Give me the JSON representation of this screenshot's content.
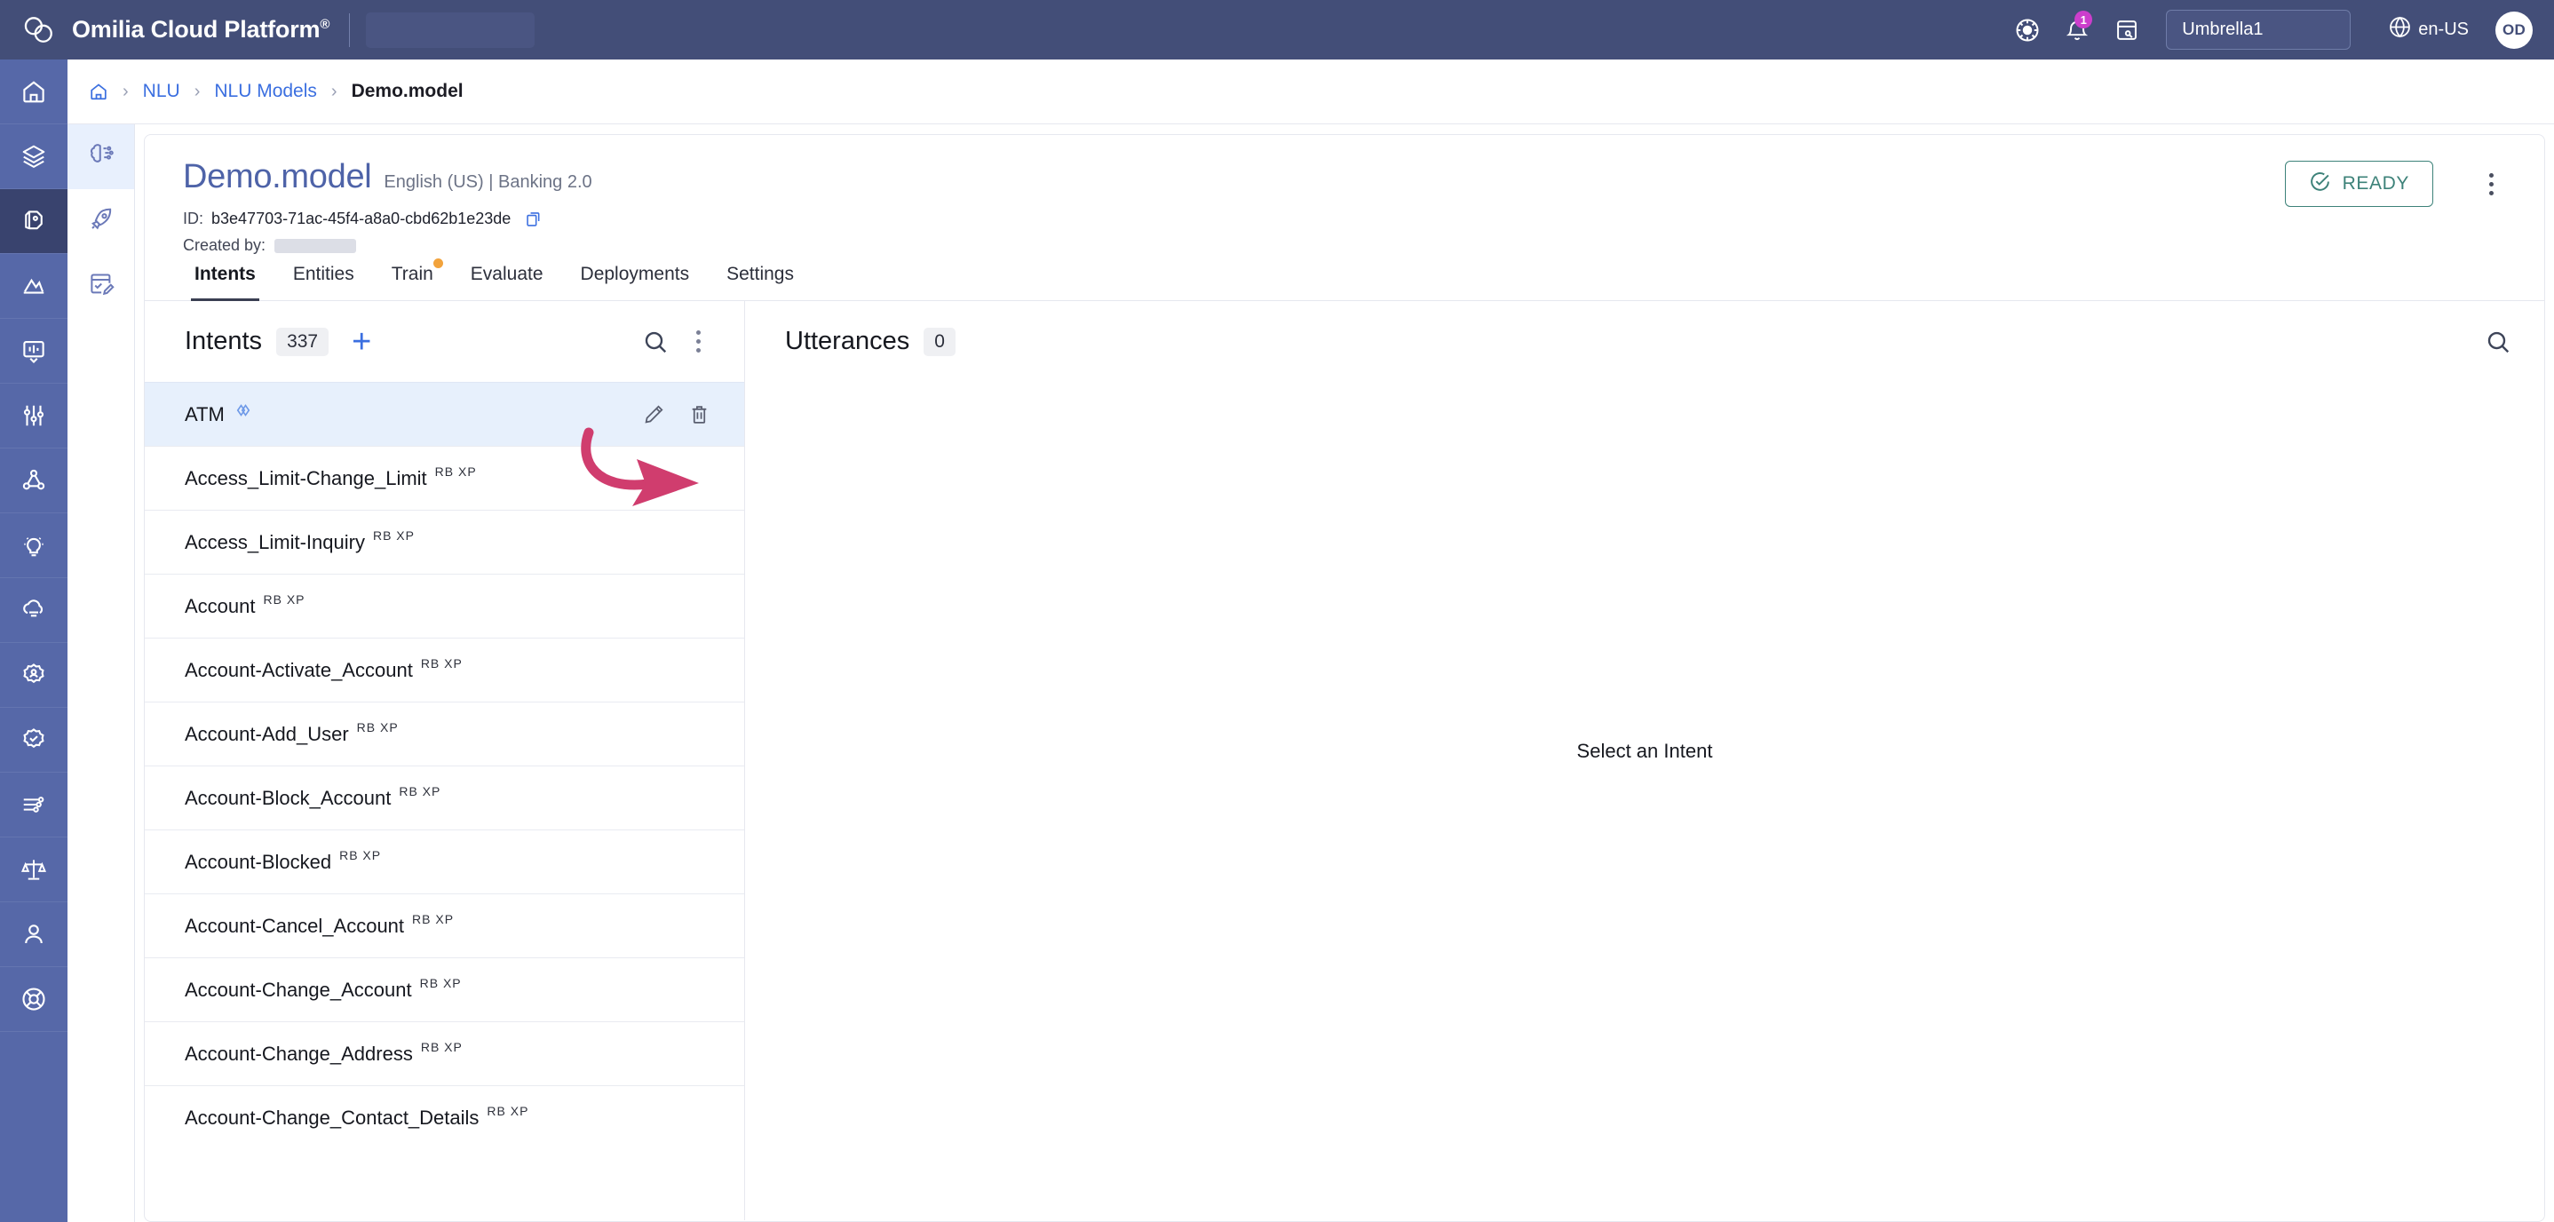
{
  "header": {
    "brand": "Omilia Cloud Platform",
    "brand_registered": "®",
    "org_name": "Umbrella1",
    "locale": "en-US",
    "avatar_initials": "OD",
    "notification_count": "1",
    "icons": [
      "settings-sun-icon",
      "notifications-bell-icon",
      "notes-icon",
      "globe-icon"
    ]
  },
  "sidebar": {
    "items": [
      {
        "name": "home",
        "label": "Home"
      },
      {
        "name": "layers",
        "label": "Layers"
      },
      {
        "name": "nlu",
        "label": "NLU",
        "active": true
      },
      {
        "name": "analytics",
        "label": "Analytics"
      },
      {
        "name": "transcripts",
        "label": "Transcripts"
      },
      {
        "name": "tuning",
        "label": "Tuning"
      },
      {
        "name": "graph",
        "label": "Graph"
      },
      {
        "name": "insights",
        "label": "Insights"
      },
      {
        "name": "cloud",
        "label": "Cloud"
      },
      {
        "name": "biometrics",
        "label": "Biometrics"
      },
      {
        "name": "verification",
        "label": "Verification"
      },
      {
        "name": "integrations",
        "label": "Integrations"
      },
      {
        "name": "compliance",
        "label": "Compliance"
      },
      {
        "name": "account",
        "label": "Account"
      },
      {
        "name": "support",
        "label": "Support"
      }
    ]
  },
  "subsidebar": {
    "items": [
      {
        "name": "nlu-models",
        "label": "NLU Models",
        "active": true
      },
      {
        "name": "deployments",
        "label": "Deployments"
      },
      {
        "name": "annotations",
        "label": "Annotations"
      }
    ]
  },
  "breadcrumb": {
    "home": "home-icon",
    "items": [
      "NLU",
      "NLU Models"
    ],
    "current": "Demo.model",
    "separator": "›"
  },
  "model": {
    "name": "Demo.model",
    "meta": "English (US) | Banking 2.0",
    "id_label": "ID:",
    "id_value": "b3e47703-71ac-45f4-a8a0-cbd62b1e23de",
    "created_by_label": "Created by:",
    "created_by_value": "",
    "status": "READY",
    "status_color": "#3d8279"
  },
  "tabs": [
    {
      "label": "Intents",
      "active": true,
      "dot": false
    },
    {
      "label": "Entities",
      "active": false,
      "dot": false
    },
    {
      "label": "Train",
      "active": false,
      "dot": true
    },
    {
      "label": "Evaluate",
      "active": false,
      "dot": false
    },
    {
      "label": "Deployments",
      "active": false,
      "dot": false
    },
    {
      "label": "Settings",
      "active": false,
      "dot": false
    }
  ],
  "intents_panel": {
    "title": "Intents",
    "count": "337",
    "add_label": "+",
    "rows": [
      {
        "name": "ATM",
        "badges": "",
        "selected": true,
        "link_icon": true
      },
      {
        "name": "Access_Limit-Change_Limit",
        "badges": "RB XP",
        "selected": false,
        "link_icon": false
      },
      {
        "name": "Access_Limit-Inquiry",
        "badges": "RB XP",
        "selected": false,
        "link_icon": false
      },
      {
        "name": "Account",
        "badges": "RB XP",
        "selected": false,
        "link_icon": false
      },
      {
        "name": "Account-Activate_Account",
        "badges": "RB XP",
        "selected": false,
        "link_icon": false
      },
      {
        "name": "Account-Add_User",
        "badges": "RB XP",
        "selected": false,
        "link_icon": false
      },
      {
        "name": "Account-Block_Account",
        "badges": "RB XP",
        "selected": false,
        "link_icon": false
      },
      {
        "name": "Account-Blocked",
        "badges": "RB XP",
        "selected": false,
        "link_icon": false
      },
      {
        "name": "Account-Cancel_Account",
        "badges": "RB XP",
        "selected": false,
        "link_icon": false
      },
      {
        "name": "Account-Change_Account",
        "badges": "RB XP",
        "selected": false,
        "link_icon": false
      },
      {
        "name": "Account-Change_Address",
        "badges": "RB XP",
        "selected": false,
        "link_icon": false
      },
      {
        "name": "Account-Change_Contact_Details",
        "badges": "RB XP",
        "selected": false,
        "link_icon": false
      }
    ]
  },
  "utterances_panel": {
    "title": "Utterances",
    "count": "0",
    "empty_message": "Select an Intent"
  },
  "annotation": {
    "type": "curved-arrow",
    "color": "#d03d6e",
    "points_to": "edit-intent-icon"
  }
}
